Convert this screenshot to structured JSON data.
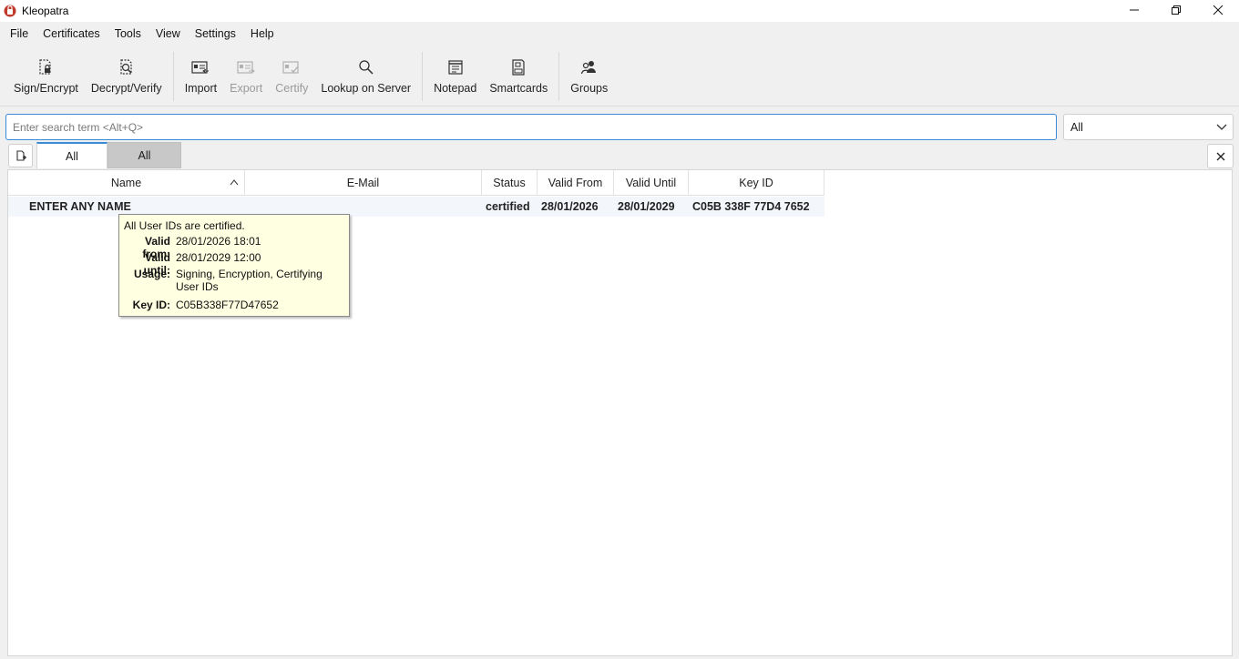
{
  "window": {
    "title": "Kleopatra",
    "controls": [
      "minimize-icon",
      "restore-icon",
      "close-icon"
    ]
  },
  "menu": [
    "File",
    "Certificates",
    "Tools",
    "View",
    "Settings",
    "Help"
  ],
  "toolbar": {
    "sign_encrypt": "Sign/Encrypt",
    "decrypt_verify": "Decrypt/Verify",
    "import": "Import",
    "export": "Export",
    "certify": "Certify",
    "lookup": "Lookup on Server",
    "notepad": "Notepad",
    "smartcards": "Smartcards",
    "groups": "Groups"
  },
  "search": {
    "placeholder": "Enter search term <Alt+Q>",
    "value": ""
  },
  "filter": {
    "selected": "All"
  },
  "tabs": [
    {
      "label": "All",
      "active": true
    },
    {
      "label": "All",
      "active": false
    }
  ],
  "columns": [
    "Name",
    "E-Mail",
    "Status",
    "Valid From",
    "Valid Until",
    "Key ID"
  ],
  "rows": [
    {
      "name": "ENTER ANY NAME",
      "email": "",
      "status": "certified",
      "valid_from": "28/01/2026",
      "valid_until": "28/01/2029",
      "key_id": "C05B 338F 77D4 7652"
    }
  ],
  "tooltip": {
    "header": "All User IDs are certified.",
    "valid_from_label": "Valid from:",
    "valid_from": "28/01/2026 18:01",
    "valid_until_label": "Valid until:",
    "valid_until": "28/01/2029 12:00",
    "usage_label": "Usage:",
    "usage_line1": "Signing, Encryption, Certifying",
    "usage_line2": "User IDs",
    "key_id_label": "Key ID:",
    "key_id": "C05B338F77D47652"
  },
  "colors": {
    "accent": "#3a8ad6",
    "tooltip_bg": "#ffffe1",
    "app_icon": "#c0392b"
  }
}
